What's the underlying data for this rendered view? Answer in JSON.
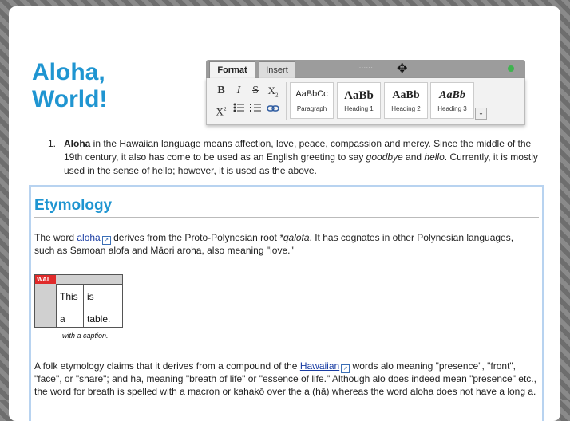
{
  "title": "Aloha, World!",
  "list": {
    "number": "1.",
    "bold": "Aloha",
    "text1": " in the Hawaiian language means affection, love, peace, compassion and mercy. Since the middle of the 19th century, it also has come to be used as an English greeting to say ",
    "em1": "goodbye",
    "text2": " and ",
    "em2": "hello",
    "text3": ". Currently, it is mostly used in the sense of hello; however, it is used as the above."
  },
  "section": {
    "heading": "Etymology",
    "p1_a": "The word ",
    "p1_link": "aloha",
    "p1_b": " derives from the Proto-Polynesian root ",
    "p1_em": "*qalofa",
    "p1_c": ". It has cognates in other Polynesian languages, such as Samoan alofa and Māori aroha, also meaning \"love.\"",
    "table": {
      "badge": "WAI",
      "cells": [
        "This",
        "is",
        "a",
        "table."
      ],
      "caption": "with a caption."
    },
    "p2_a": "A folk etymology claims that it derives from a compound of the ",
    "p2_link": "Hawaiian",
    "p2_b": " words alo meaning \"presence\", \"front\", \"face\", or \"share\"; and ha, meaning \"breath of life\" or \"essence of life.\" Although alo does indeed mean \"presence\" etc., the word for breath is spelled with a macron or kahakō over the a (hā) whereas the word aloha does not have a long a."
  },
  "toolbar": {
    "tabs": {
      "format": "Format",
      "insert": "Insert"
    },
    "grip": "::::::",
    "buttons": {
      "bold": "B",
      "italic": "I",
      "strike": "S",
      "subscript": "X",
      "sub_mark": "2",
      "superscript": "X",
      "sup_mark": "2"
    },
    "styles": [
      {
        "sample": "AaBbCc",
        "label": "Paragraph"
      },
      {
        "sample": "AaBb",
        "label": "Heading 1"
      },
      {
        "sample": "AaBb",
        "label": "Heading 2"
      },
      {
        "sample": "AaBb",
        "label": "Heading 3"
      }
    ],
    "more": "⌄",
    "icons": {
      "move": "✥",
      "ext": "↗"
    }
  }
}
